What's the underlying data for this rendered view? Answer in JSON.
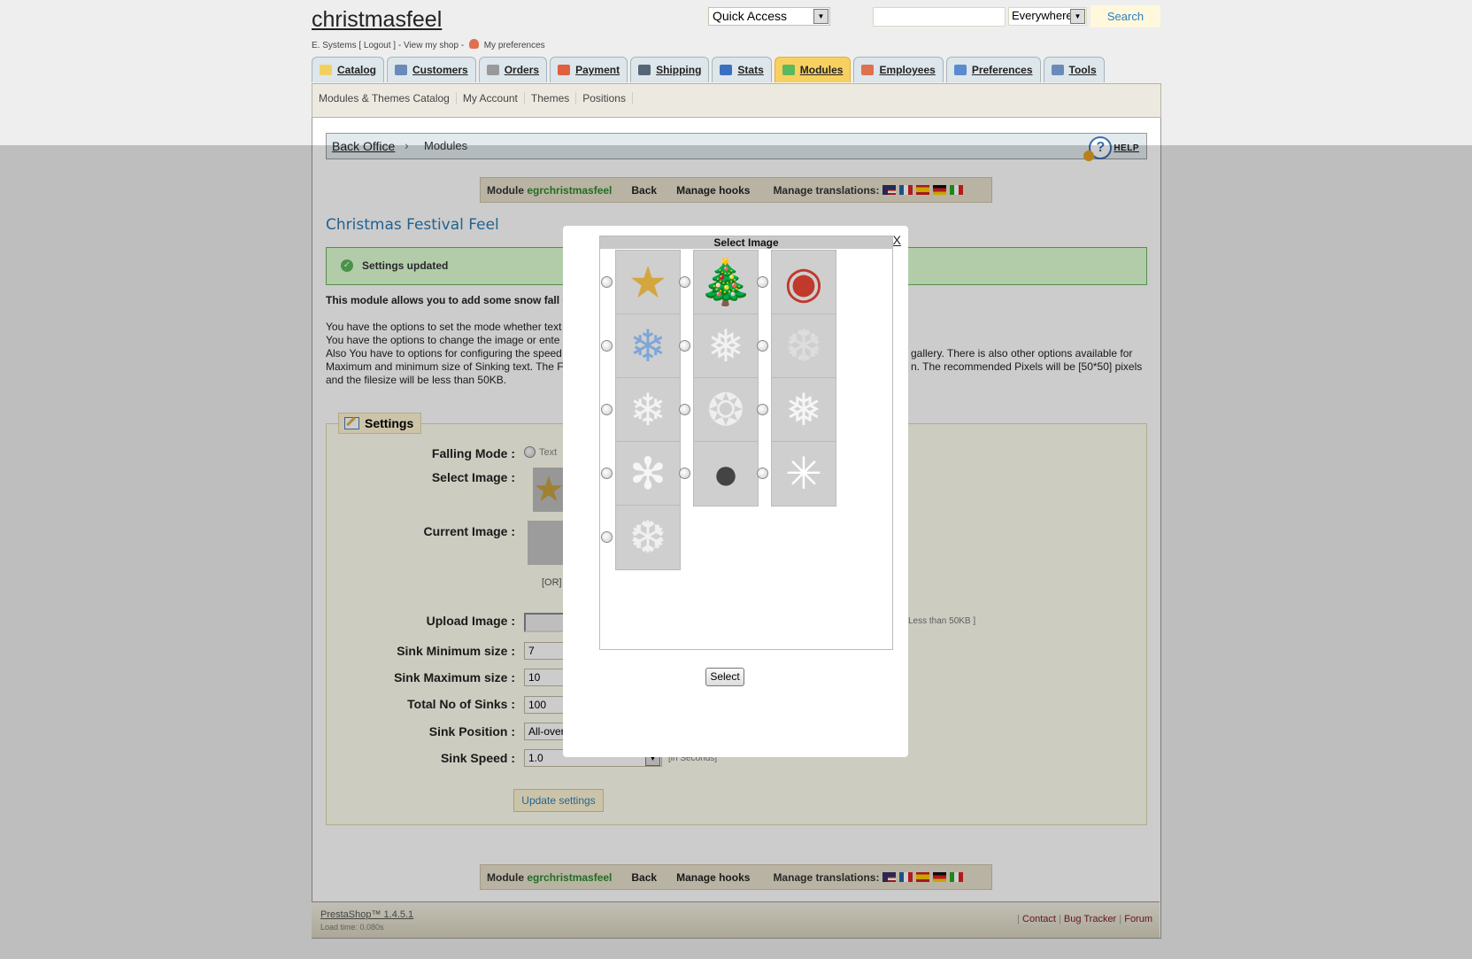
{
  "header": {
    "shop_title": "christmasfeel",
    "user_name": "E. Systems",
    "logout": "Logout",
    "view_shop": "View my shop",
    "my_preferences": "My preferences",
    "quick_access": "Quick Access",
    "search_value": "",
    "search_scope": "Everywhere",
    "search_button": "Search"
  },
  "tabs": [
    {
      "label": "Catalog",
      "icon": "folder-icon",
      "color": "#f2d060"
    },
    {
      "label": "Customers",
      "icon": "customer-icon",
      "color": "#6a8ab8"
    },
    {
      "label": "Orders",
      "icon": "cart-icon",
      "color": "#999999"
    },
    {
      "label": "Payment",
      "icon": "payment-icon",
      "color": "#e06040"
    },
    {
      "label": "Shipping",
      "icon": "truck-icon",
      "color": "#556677"
    },
    {
      "label": "Stats",
      "icon": "chart-icon",
      "color": "#3a70c0"
    },
    {
      "label": "Modules",
      "icon": "puzzle-icon",
      "color": "#5cb85c",
      "active": true
    },
    {
      "label": "Employees",
      "icon": "employee-icon",
      "color": "#e07050"
    },
    {
      "label": "Preferences",
      "icon": "preferences-icon",
      "color": "#5a8ad0"
    },
    {
      "label": "Tools",
      "icon": "wrench-icon",
      "color": "#6a8ab8"
    }
  ],
  "subnav": [
    "Modules & Themes Catalog",
    "My Account",
    "Themes",
    "Positions"
  ],
  "breadcrumb": {
    "root": "Back Office",
    "separator": "›",
    "current": "Modules",
    "help": "HELP"
  },
  "module_bar": {
    "module_prefix": "Module",
    "module_name": "egrchristmasfeel",
    "back": "Back",
    "manage_hooks": "Manage hooks",
    "manage_translations": "Manage translations:",
    "flags": [
      "en",
      "fr",
      "es",
      "de",
      "it"
    ]
  },
  "page_title": "Christmas Festival Feel",
  "confirmation": "Settings updated",
  "description": {
    "lead": "This module allows you to add some snow fall e",
    "lines": [
      "You have the options to set the mode whether text",
      "You have the options to change the image or ente",
      "Also You have to options for configuring the speed",
      "Maximum and minimum size of Sinking text. The F",
      "and the filesize will be less than 50KB."
    ],
    "right_lines": [
      "gallery. There is also other options available for",
      "n. The recommended Pixels will be [50*50] pixels"
    ]
  },
  "settings": {
    "legend": "Settings",
    "falling_mode_label": "Falling Mode :",
    "falling_mode_option": "Text",
    "select_image_label": "Select Image :",
    "current_image_label": "Current Image :",
    "or_text": "[OR]",
    "upload_image_label": "Upload Image :",
    "upload_hint": "Less than 50KB ]",
    "sink_min_label": "Sink Minimum size :",
    "sink_min_value": "7",
    "sink_max_label": "Sink Maximum size :",
    "sink_max_value": "10",
    "total_sinks_label": "Total No of Sinks :",
    "total_sinks_value": "100",
    "sink_position_label": "Sink Position :",
    "sink_position_value": "All-over",
    "sink_speed_label": "Sink Speed :",
    "sink_speed_value": "1.0",
    "sink_speed_hint": "[in Seconds]",
    "update_button": "Update settings"
  },
  "footer": {
    "version": "PrestaShop™ 1.4.5.1",
    "load_time": "Load time: 0.080s",
    "links": [
      "Contact",
      "Bug Tracker",
      "Forum"
    ]
  },
  "modal": {
    "title": "Select Image",
    "close": "X",
    "select_button": "Select",
    "images": [
      {
        "name": "star",
        "glyph": "★",
        "color": "#d4a640"
      },
      {
        "name": "christmas-tree",
        "glyph": "🎄",
        "color": "#2e7d32"
      },
      {
        "name": "snow-globe",
        "glyph": "◉",
        "color": "#c0392b"
      },
      {
        "name": "snowflake-blue",
        "glyph": "❄",
        "color": "#7ea6d8"
      },
      {
        "name": "snowflake-fuzzy",
        "glyph": "❅",
        "color": "#f2f2f2"
      },
      {
        "name": "snowflake-faint",
        "glyph": "❆",
        "color": "#dddddd"
      },
      {
        "name": "snowflake-white",
        "glyph": "❄",
        "color": "#f4f4f4"
      },
      {
        "name": "snowflake-hex",
        "glyph": "❂",
        "color": "#eeeeee"
      },
      {
        "name": "snowflake-branch",
        "glyph": "❅",
        "color": "#f6f6f6"
      },
      {
        "name": "snowflake-star",
        "glyph": "✻",
        "color": "#f6f6f6"
      },
      {
        "name": "snowball-dotted",
        "glyph": "●",
        "color": "#444444"
      },
      {
        "name": "asterisk-flake",
        "glyph": "✳",
        "color": "#ffffff"
      },
      {
        "name": "snowflake-outline",
        "glyph": "❆",
        "color": "#f0f0f0"
      }
    ]
  }
}
